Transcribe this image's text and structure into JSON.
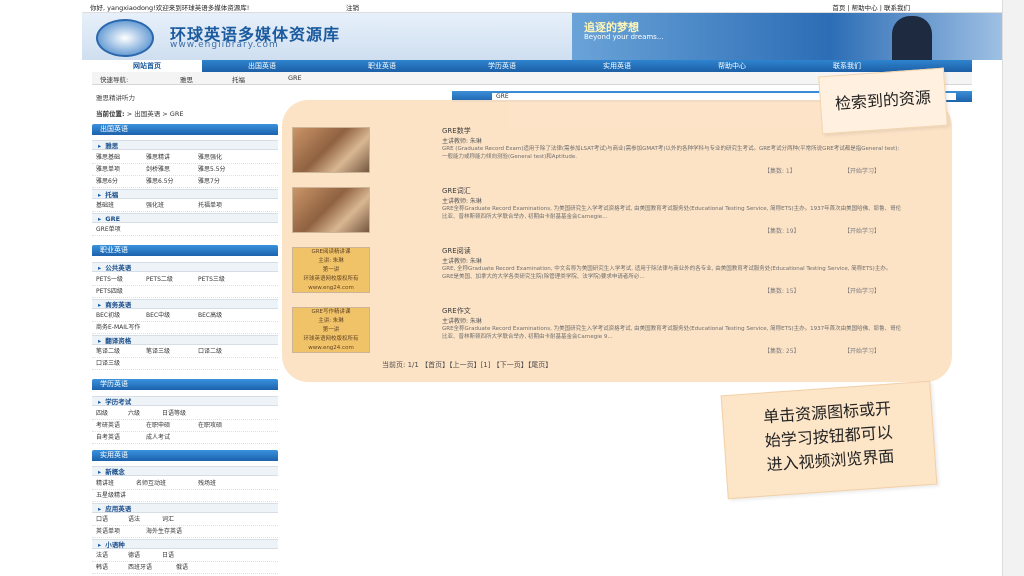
{
  "topbar": {
    "welcome": "你好, yangxiaodong!欢迎来到环球英语多媒体资源库!",
    "logout": "注销",
    "links": "首页 | 帮助中心 | 联系我们"
  },
  "banner": {
    "title": "环球英语多媒体资源库",
    "url": "www.englibrary.com",
    "slogan": "追逐的梦想",
    "slogan_en": "Beyond your dreams..."
  },
  "nav": {
    "items": [
      "网站首页",
      "出国英语",
      "职业英语",
      "学历英语",
      "实用英语",
      "帮助中心",
      "联系我们"
    ]
  },
  "quicknav": {
    "label": "快速导航:",
    "items": [
      "雅思",
      "托福",
      "GRE"
    ]
  },
  "strip": {
    "left": "雅思精讲听力",
    "search_value": "GRE"
  },
  "location": {
    "label": "当前位置:",
    "path": "> 出国英语 > GRE"
  },
  "sidebar": {
    "cat1": "出国英语",
    "sub_ielts": "雅思",
    "ielts_rows": [
      [
        "雅思基础",
        "雅思精讲",
        "雅思强化"
      ],
      [
        "雅思单项",
        "剑桥雅思",
        "雅思5.5分"
      ],
      [
        "雅思6分",
        "雅思6.5分",
        "雅思7分"
      ]
    ],
    "sub_toefl": "托福",
    "toefl_rows": [
      [
        "基础班",
        "强化班",
        "托福单项"
      ]
    ],
    "sub_gre": "GRE",
    "gre_rows": [
      [
        "GRE单项"
      ]
    ],
    "cat2": "职业英语",
    "sub_public": "公共英语",
    "public_rows": [
      [
        "PETS一级",
        "PETS二级",
        "PETS三级"
      ],
      [
        "PETS四级"
      ]
    ],
    "sub_biz": "商务英语",
    "biz_rows": [
      [
        "BEC初级",
        "BEC中级",
        "BEC高级"
      ],
      [
        "商务E-MAIL写作"
      ]
    ],
    "sub_trans": "翻译资格",
    "trans_rows": [
      [
        "笔译二级",
        "笔译三级",
        "口译二级"
      ],
      [
        "口译三级"
      ]
    ],
    "cat3": "学历英语",
    "sub_exam": "学历考试",
    "exam_rows": [
      [
        "四级",
        "六级",
        "日语等级"
      ],
      [
        "考研英语",
        "在职申硕",
        "在职攻硕"
      ],
      [
        "自考英语",
        "成人考试"
      ]
    ],
    "cat4": "实用英语",
    "sub_nce": "新概念",
    "nce_rows": [
      [
        "精讲班",
        "名师互动班",
        "残场班"
      ],
      [
        "五星级精讲"
      ]
    ],
    "sub_applied": "应用英语",
    "applied_rows": [
      [
        "口语",
        "语法",
        "词汇"
      ],
      [
        "英语单项",
        "海外生存英语"
      ]
    ],
    "sub_minor": "小语种",
    "minor_rows": [
      [
        "法语",
        "德语",
        "日语"
      ],
      [
        "韩语",
        "西班牙语",
        "俄语"
      ]
    ]
  },
  "entries": [
    {
      "title": "GRE数学",
      "teacher": "主讲教师: 朱琳",
      "desc": "GRE (Graduate Record Exam)适用于除了法律(需参加LSAT考试)与商业(需参加GMAT考)以外的各种学科与专业的研究生考试。GRE考试分两种(平常所说GRE考试都是指General test): 一般能力或称能力倾向测验(General test)和Aptitude.",
      "count": "【集数: 1】",
      "start": "【开始学习】",
      "thumb": "video"
    },
    {
      "title": "GRE词汇",
      "teacher": "主讲教师: 朱琳",
      "desc": "GRE全称Graduate Record Examinations, 为美国研究生入学考试资格考试, 由美国教育考试服务处(Educational Testing Service, 简称ETS)主办。1937年首次由美国哈佛、耶鲁、哥伦比亚、普林斯顿四所大学联合举办, 初期由卡耐基基金会Carnegie...",
      "count": "【集数: 19】",
      "start": "【开始学习】",
      "thumb": "video"
    },
    {
      "title": "GRE阅读",
      "teacher": "主讲教师: 朱琳",
      "desc": "GRE, 全称Graduate Record Examination, 中文名称为美国研究生入学考试, 适用于除法律与商业外的各专业, 由美国教育考试服务处(Educational Testing Service, 简称ETS)主办。GRE是美国、加拿大的大学各类研究生院(除管理类学院、法学院)要求申请者所必...",
      "count": "【集数: 15】",
      "start": "【开始学习】",
      "thumb": "card",
      "card_lines": [
        "GRE阅读精讲课",
        "主讲: 朱琳",
        "第一讲",
        "环球英语网校版权所有",
        "www.eng24.com"
      ]
    },
    {
      "title": "GRE作文",
      "teacher": "主讲教师: 朱琳",
      "desc": "GRE全称Graduate Record Examinations, 为美国研究生入学考试资格考试, 由美国教育考试服务处(Educational Testing Service, 简称ETS)主办。1937年首次由美国哈佛、耶鲁、哥伦比亚、普林斯顿四所大学联合举办, 初期由卡耐基基金会Carnegie 9...",
      "count": "【集数: 25】",
      "start": "【开始学习】",
      "thumb": "card",
      "card_lines": [
        "GRE写作精讲课",
        "主讲: 朱琳",
        "第一讲",
        "环球英语网校版权所有",
        "www.eng24.com"
      ]
    }
  ],
  "pager": "当前页: 1/1 【首页】【上一页】[1] 【下一页】【尾页】",
  "callouts": {
    "one": "检索到的资源",
    "two_lines": [
      "单击资源图标或开",
      "始学习按钮都可以",
      "进入视频浏览界面"
    ]
  }
}
